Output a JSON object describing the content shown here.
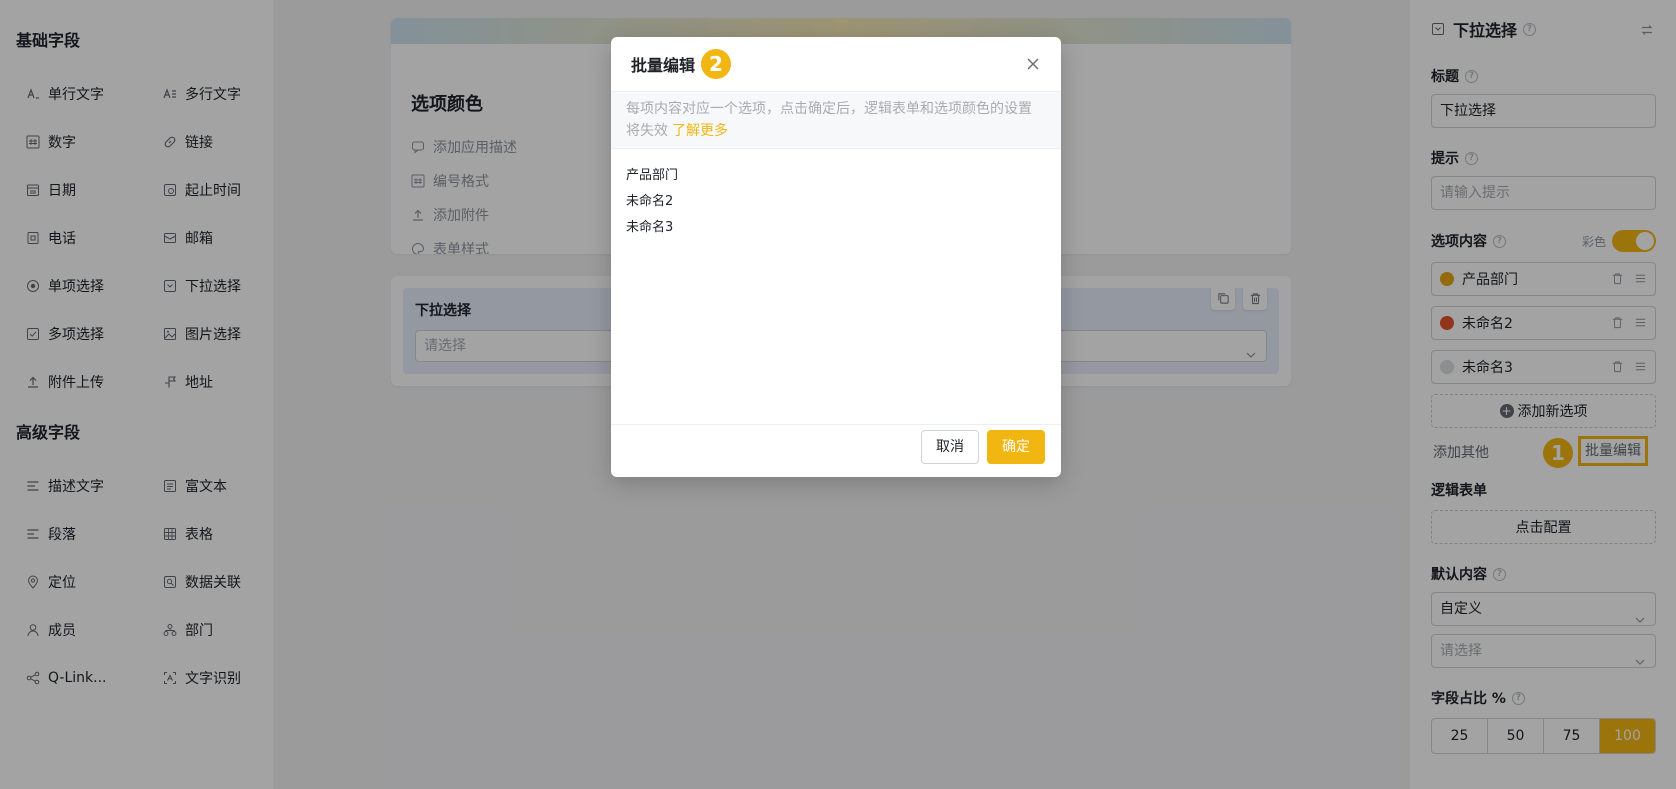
{
  "left": {
    "basic_title": "基础字段",
    "basic_fields": [
      {
        "label": "单行文字",
        "icon": "single-line-text-icon"
      },
      {
        "label": "多行文字",
        "icon": "multi-line-text-icon"
      },
      {
        "label": "数字",
        "icon": "number-icon"
      },
      {
        "label": "链接",
        "icon": "link-icon"
      },
      {
        "label": "日期",
        "icon": "date-icon"
      },
      {
        "label": "起止时间",
        "icon": "time-range-icon"
      },
      {
        "label": "电话",
        "icon": "phone-icon"
      },
      {
        "label": "邮箱",
        "icon": "mail-icon"
      },
      {
        "label": "单项选择",
        "icon": "radio-icon"
      },
      {
        "label": "下拉选择",
        "icon": "dropdown-icon"
      },
      {
        "label": "多项选择",
        "icon": "checkbox-icon"
      },
      {
        "label": "图片选择",
        "icon": "image-select-icon"
      },
      {
        "label": "附件上传",
        "icon": "upload-icon"
      },
      {
        "label": "地址",
        "icon": "address-icon"
      }
    ],
    "advanced_title": "高级字段",
    "advanced_fields": [
      {
        "label": "描述文字",
        "icon": "description-icon"
      },
      {
        "label": "富文本",
        "icon": "rich-text-icon"
      },
      {
        "label": "段落",
        "icon": "paragraph-icon"
      },
      {
        "label": "表格",
        "icon": "table-icon"
      },
      {
        "label": "定位",
        "icon": "location-icon"
      },
      {
        "label": "数据关联",
        "icon": "data-link-icon"
      },
      {
        "label": "成员",
        "icon": "member-icon"
      },
      {
        "label": "部门",
        "icon": "department-icon"
      },
      {
        "label": "Q-Link...",
        "icon": "qlink-icon"
      },
      {
        "label": "文字识别",
        "icon": "ocr-icon"
      }
    ]
  },
  "canvas": {
    "color_card": {
      "title": "选项颜色",
      "menu": [
        "添加应用描述",
        "编号格式",
        "添加附件",
        "表单样式"
      ]
    },
    "field_card": {
      "label": "下拉选择",
      "placeholder": "请选择"
    }
  },
  "right": {
    "header": "下拉选择",
    "title_label": "标题",
    "title_value": "下拉选择",
    "hint_label": "提示",
    "hint_placeholder": "请输入提示",
    "options_label": "选项内容",
    "colorful_label": "彩色",
    "options": [
      {
        "text": "产品部门",
        "color": "#e6a817"
      },
      {
        "text": "未命名2",
        "color": "#e5532d"
      },
      {
        "text": "未命名3",
        "color": "#dcdee0"
      }
    ],
    "add_option": "添加新选项",
    "add_other": "添加其他",
    "batch_edit": "批量编辑",
    "badge_1": "1",
    "logic_label": "逻辑表单",
    "logic_button": "点击配置",
    "default_label": "默认内容",
    "default_value": "自定义",
    "default_placeholder": "请选择",
    "ratio_label": "字段占比 %",
    "ratios": [
      "25",
      "50",
      "75",
      "100"
    ]
  },
  "modal": {
    "title": "批量编辑",
    "badge_2": "2",
    "tip": "每项内容对应一个选项，点击确定后，逻辑表单和选项颜色的设置将失效",
    "learn_more": "了解更多",
    "lines": [
      "产品部门",
      "未命名2",
      "未命名3"
    ],
    "cancel": "取消",
    "confirm": "确定"
  },
  "colors": {
    "accent": "#f2b612",
    "overlay": "rgba(0,0,0,0.36)"
  }
}
